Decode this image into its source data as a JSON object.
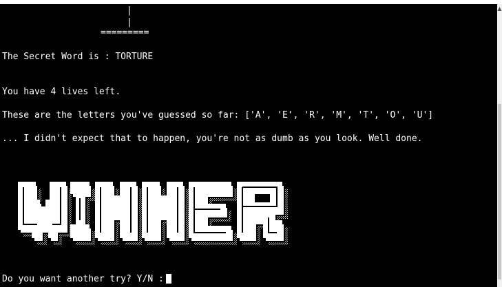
{
  "terminal": {
    "gallows_bottom": "=========",
    "gallows_post_1": "|",
    "gallows_post_2": "|",
    "secret_word_line": "The Secret Word is : TORTURE",
    "lives_line": "You have 4 lives left.",
    "guessed_line": "These are the letters you've guessed so far: ['A', 'E', 'R', 'M', 'T', 'O', 'U']",
    "message_line": "... I didn't expect that to happen, you're not as dumb as you look. Well done.",
    "banner_word": "WINNER",
    "prompt": "Do you want another try? Y/N :"
  },
  "colors": {
    "background": "#000000",
    "text": "#ffffff"
  }
}
